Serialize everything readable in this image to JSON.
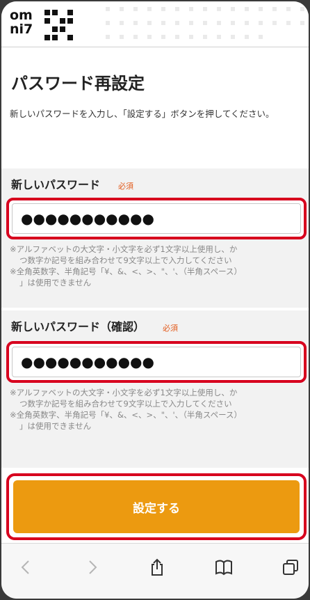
{
  "logo": {
    "line1": "om",
    "line2": "ni7"
  },
  "page_title": "パスワード再設定",
  "description": "新しいパスワードを入力し、「設定する」ボタンを押してください。",
  "password": {
    "label": "新しいパスワード",
    "required": "必須",
    "value": "●●●●●●●●●●●",
    "notes": [
      "※アルファベットの大文字・小文字を必ず1文字以上使用し、か",
      "つ数字か記号を組み合わせて9文字以上で入力してください",
      "※全角英数字、半角記号「¥、&、<、>、\"、'、（半角スペース）",
      "」は使用できません"
    ]
  },
  "password_confirm": {
    "label": "新しいパスワード（確認）",
    "required": "必須",
    "value": "●●●●●●●●●●●",
    "notes": [
      "※アルファベットの大文字・小文字を必ず1文字以上使用し、か",
      "つ数字か記号を組み合わせて9文字以上で入力してください",
      "※全角英数字、半角記号「¥、&、<、>、\"、'、（半角スペース）",
      "」は使用できません"
    ]
  },
  "submit_label": "設定する",
  "toolbar": {
    "back_icon": "chevron-left-icon",
    "forward_icon": "chevron-right-icon",
    "share_icon": "share-icon",
    "bookmarks_icon": "book-icon",
    "tabs_icon": "tabs-icon"
  },
  "colors": {
    "accent": "#ec9a10",
    "highlight": "#d7001e",
    "required": "#e35a1b"
  }
}
